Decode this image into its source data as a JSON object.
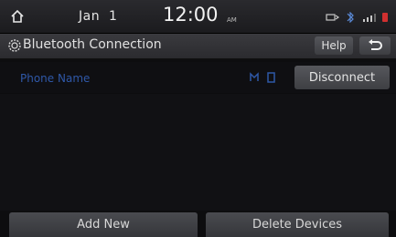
{
  "status": {
    "date": "Jan  1",
    "time": "12:00",
    "ampm": "AM"
  },
  "header": {
    "title": "Bluetooth Connection",
    "help_label": "Help"
  },
  "device": {
    "name": "Phone Name",
    "disconnect_label": "Disconnect"
  },
  "footer": {
    "add_new_label": "Add New",
    "delete_devices_label": "Delete Devices"
  },
  "icons": {
    "home": "home-icon",
    "back": "back-arrow-icon",
    "bluetooth_settings": "bluetooth-gear-icon",
    "signal": "signal-icon",
    "battery": "battery-icon"
  },
  "colors": {
    "accent_blue": "#2f58a8",
    "alert_red": "#d03030"
  }
}
